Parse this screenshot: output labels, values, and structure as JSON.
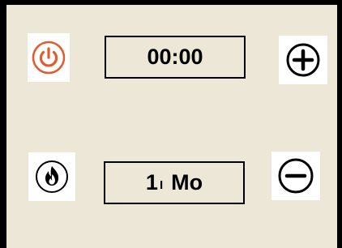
{
  "controls": {
    "power_button": {
      "icon": "power-icon",
      "color": "#e35b2c"
    },
    "plus_button": {
      "icon": "plus-icon",
      "color": "#000000"
    },
    "flame_button": {
      "icon": "flame-icon",
      "color": "#000000"
    },
    "minus_button": {
      "icon": "minus-icon",
      "color": "#000000"
    }
  },
  "time_display": {
    "value": "00:00"
  },
  "mode_display": {
    "value": "1",
    "separator": "I",
    "unit": "Mo"
  },
  "colors": {
    "panel_background": "#ece7d6",
    "border": "#000000",
    "power_accent": "#e35b2c"
  }
}
